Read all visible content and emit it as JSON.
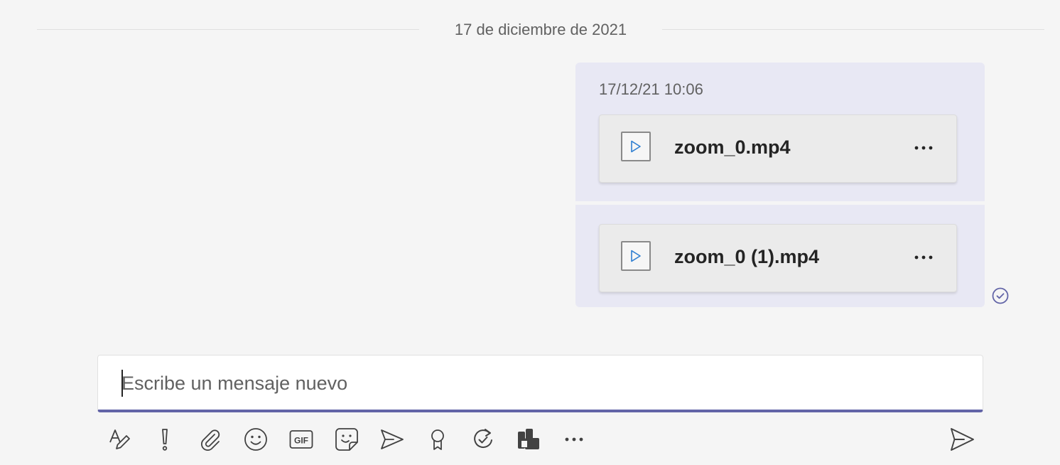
{
  "date_divider": {
    "label": "17 de diciembre de 2021"
  },
  "messages": [
    {
      "timestamp": "17/12/21 10:06",
      "attachment": {
        "file_name": "zoom_0.mp4",
        "icon": "video-file-icon",
        "more_icon": "more-options-icon"
      }
    },
    {
      "timestamp": "",
      "attachment": {
        "file_name": "zoom_0 (1).mp4",
        "icon": "video-file-icon",
        "more_icon": "more-options-icon"
      }
    }
  ],
  "read_receipt": {
    "icon": "seen-check-icon",
    "color": "#6264a7"
  },
  "compose": {
    "placeholder": "Escribe un mensaje nuevo",
    "value": "",
    "accent_color": "#6264a7"
  },
  "toolbar": {
    "items": [
      "format-icon",
      "important-icon",
      "attach-icon",
      "emoji-icon",
      "gif-icon",
      "sticker-icon",
      "meet-now-icon",
      "praise-icon",
      "loop-icon",
      "app-icon",
      "more-options-icon"
    ],
    "gif_label": "GIF",
    "send_icon": "send-icon"
  }
}
